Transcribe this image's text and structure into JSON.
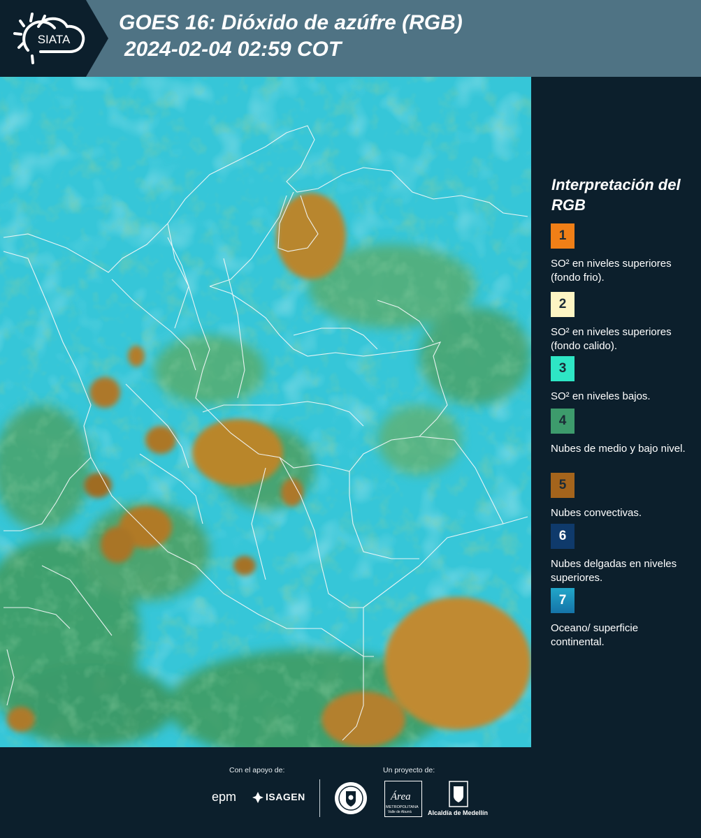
{
  "header": {
    "logo_text": "SIATA",
    "title_line1": "GOES 16: Dióxido de azúfre (RGB)",
    "title_line2": "2024-02-04 02:59 COT"
  },
  "legend": {
    "title": "Interpretación del RGB",
    "items": [
      {
        "number": "1",
        "color": "#f07f17",
        "description": "SO² en niveles superiores (fondo frio)."
      },
      {
        "number": "2",
        "color": "#fdf5c3",
        "description": "SO² en niveles superiores (fondo calido)."
      },
      {
        "number": "3",
        "color": "#2ee6c5",
        "description": "SO² en niveles bajos."
      },
      {
        "number": "4",
        "color": "#3d9b6c",
        "description": "Nubes de medio y bajo nivel."
      },
      {
        "number": "5",
        "color": "#a4641c",
        "description": "Nubes convectivas."
      },
      {
        "number": "6",
        "color": "#0f3a6b",
        "description": "Nubes delgadas en niveles superiores."
      },
      {
        "number": "7",
        "color": "#1c8fbf",
        "description": "Oceano/ superficie continental."
      }
    ]
  },
  "footer": {
    "support_label": "Con el apoyo de:",
    "project_label": "Un proyecto de:",
    "sponsor_epm": "epm",
    "sponsor_isagen": "ISAGEN",
    "partner_area_name": "Área",
    "partner_area_sub": "METROPOLITANA",
    "partner_area_sub2": "Valle de Aburrá",
    "partner_alcaldia": "Alcaldía de Medellín"
  }
}
